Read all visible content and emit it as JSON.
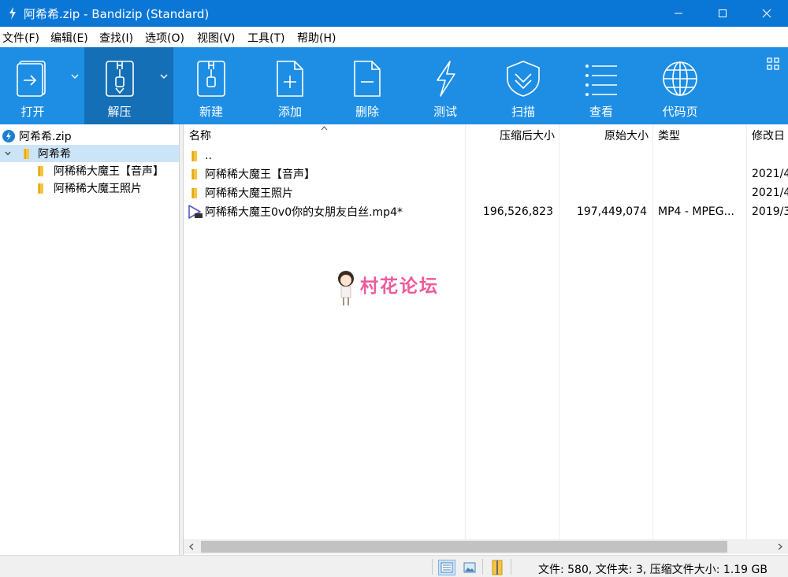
{
  "window": {
    "title": "阿希希.zip - Bandizip (Standard)",
    "icons": {
      "app": "bandizip-icon",
      "minimize": "minimize-icon",
      "maximize": "maximize-icon",
      "close": "close-icon"
    }
  },
  "menu": [
    {
      "label": "文件(F)"
    },
    {
      "label": "编辑(E)"
    },
    {
      "label": "查找(I)"
    },
    {
      "label": "选项(O)"
    },
    {
      "label": "视图(V)"
    },
    {
      "label": "工具(T)"
    },
    {
      "label": "帮助(H)"
    }
  ],
  "toolbar": {
    "open": "打开",
    "extract": "解压",
    "new": "新建",
    "add": "添加",
    "delete": "删除",
    "test": "测试",
    "scan": "扫描",
    "view": "查看",
    "codepage": "代码页",
    "active_tool": "extract",
    "accent_color": "#1e8ee4",
    "active_color": "#156fb6"
  },
  "tree": {
    "root": "阿希希.zip",
    "folder": "阿希希",
    "children": [
      "阿稀稀大魔王【音声】",
      "阿稀稀大魔王照片"
    ]
  },
  "filelist": {
    "columns": {
      "name": "名称",
      "compressed": "压缩后大小",
      "original": "原始大小",
      "type": "类型",
      "modified": "修改日"
    },
    "rows": [
      {
        "name": "..",
        "compressed": "",
        "original": "",
        "type": "",
        "modified": "",
        "icon": "folder-icon"
      },
      {
        "name": "阿稀稀大魔王【音声】",
        "compressed": "",
        "original": "",
        "type": "",
        "modified": "2021/4",
        "icon": "folder-icon"
      },
      {
        "name": "阿稀稀大魔王照片",
        "compressed": "",
        "original": "",
        "type": "",
        "modified": "2021/4",
        "icon": "folder-icon"
      },
      {
        "name": "阿稀稀大魔王0v0你的女朋友白丝.mp4*",
        "compressed": "196,526,823",
        "original": "197,449,074",
        "type": "MP4 - MPEG...",
        "modified": "2019/3",
        "icon": "video-file-icon"
      }
    ]
  },
  "watermark": {
    "text": "村花论坛"
  },
  "status": {
    "text": "文件: 580, 文件夹: 3, 压缩文件大小: 1.19 GB"
  }
}
